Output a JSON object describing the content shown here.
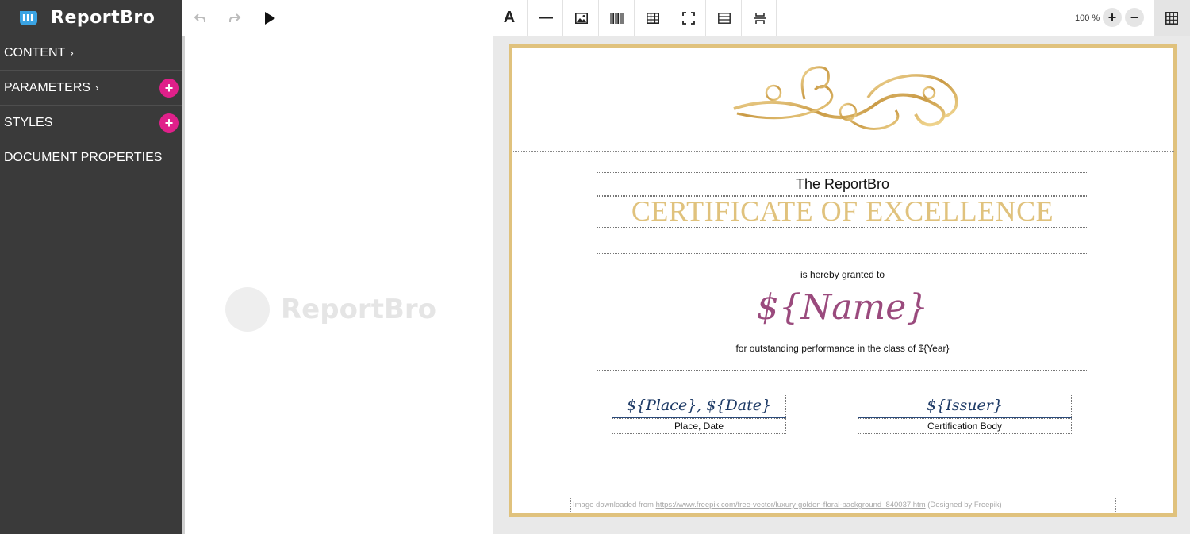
{
  "app": {
    "name": "ReportBro",
    "watermark": "ReportBro"
  },
  "sidebar": {
    "items": [
      {
        "label": "CONTENT",
        "chevron": "›",
        "add": false
      },
      {
        "label": "PARAMETERS",
        "chevron": "›",
        "add": true
      },
      {
        "label": "STYLES",
        "chevron": "",
        "add": true
      },
      {
        "label": "DOCUMENT PROPERTIES",
        "chevron": "",
        "add": false
      }
    ],
    "add_icon": "+"
  },
  "toolbar": {
    "undo_icon": "undo-icon",
    "redo_icon": "redo-icon",
    "preview_icon": "play-icon",
    "text_tool": "A",
    "zoom_label": "100 %",
    "zoom_in": "+",
    "zoom_out": "−"
  },
  "document": {
    "title_line": "The ReportBro",
    "certificate_title": "CERTIFICATE OF EXCELLENCE",
    "granted_text": "is hereby granted to",
    "name_placeholder": "${Name}",
    "performance_text": "for outstanding performance in the class of ${Year}",
    "place_date_value": "${Place}, ${Date}",
    "place_date_label": "Place, Date",
    "issuer_value": "${Issuer}",
    "issuer_label": "Certification Body",
    "credit_prefix": "Image downloaded from ",
    "credit_url": "https://www.freepik.com/free-vector/luxury-golden-floral-background_840037.htm",
    "credit_suffix": " (Designed by Freepik)",
    "colors": {
      "gold": "#e0c27d",
      "name": "#9a4a7d",
      "signature": "#1d3a66",
      "accent": "#e0208a"
    }
  }
}
